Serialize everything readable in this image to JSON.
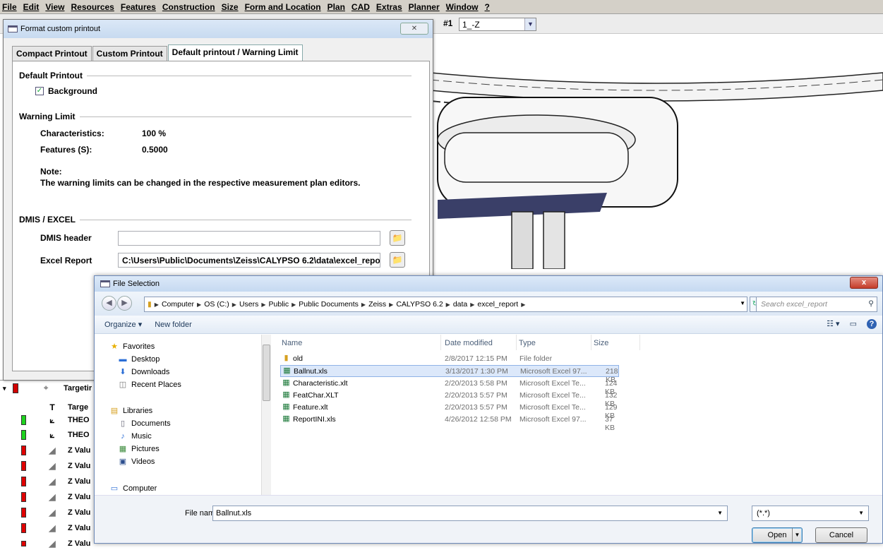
{
  "menubar": {
    "items": [
      "File",
      "Edit",
      "View",
      "Resources",
      "Features",
      "Construction",
      "Size",
      "Form and Location",
      "Plan",
      "CAD",
      "Extras",
      "Planner",
      "Window",
      "?"
    ]
  },
  "toolbar": {
    "plan_number": "#1",
    "plan_combo_value": "1_-Z"
  },
  "tree": {
    "header": "Targetir",
    "rows": [
      {
        "icon": "text-icon",
        "label": "Targe",
        "flag": ""
      },
      {
        "icon": "axis-icon",
        "label": "THEO",
        "flag": "green"
      },
      {
        "icon": "axis-icon",
        "label": "THEO",
        "flag": "green"
      },
      {
        "icon": "feature-icon",
        "label": "Z Valu",
        "flag": "red"
      },
      {
        "icon": "feature-icon",
        "label": "Z Valu",
        "flag": "red"
      },
      {
        "icon": "feature-icon",
        "label": "Z Valu",
        "flag": "red"
      },
      {
        "icon": "feature-icon",
        "label": "Z Valu",
        "flag": "red"
      },
      {
        "icon": "feature-icon",
        "label": "Z Valu",
        "flag": "red"
      },
      {
        "icon": "feature-icon",
        "label": "Z Valu",
        "flag": "red"
      },
      {
        "icon": "feature-icon",
        "label": "Z Valu",
        "flag": "red"
      }
    ]
  },
  "format_dialog": {
    "title": "Format custom printout",
    "close_label": "✕",
    "tabs": [
      "Compact Printout",
      "Custom Printout",
      "Default printout / Warning Limit"
    ],
    "default_printout": {
      "group_label": "Default Printout",
      "background_label": "Background",
      "background_checked": true
    },
    "warning_limit": {
      "group_label": "Warning Limit",
      "characteristics_label": "Characteristics:",
      "characteristics_value": "100 %",
      "features_label": "Features (S):",
      "features_value": "0.5000",
      "note_title": "Note:",
      "note_text": "The warning limits can be changed in the respective measurement plan editors."
    },
    "dmis_excel": {
      "group_label": "DMIS / EXCEL",
      "dmis_header_label": "DMIS header",
      "dmis_header_value": "",
      "excel_report_label": "Excel Report",
      "excel_report_value": "C:\\Users\\Public\\Documents\\Zeiss\\CALYPSO 6.2\\data\\excel_report"
    }
  },
  "file_dialog": {
    "title": "File Selection",
    "close_label": "x",
    "breadcrumb": [
      "Computer",
      "OS (C:)",
      "Users",
      "Public",
      "Public Documents",
      "Zeiss",
      "CALYPSO 6.2",
      "data",
      "excel_report"
    ],
    "search_placeholder": "Search excel_report",
    "organize_label": "Organize ▾",
    "new_folder_label": "New folder",
    "nav": [
      {
        "icon": "star-icon",
        "label": "Favorites"
      },
      {
        "icon": "desktop-icon",
        "label": "Desktop"
      },
      {
        "icon": "downloads-icon",
        "label": "Downloads"
      },
      {
        "icon": "recent-icon",
        "label": "Recent Places"
      },
      {
        "icon": "libraries-icon",
        "label": "Libraries"
      },
      {
        "icon": "documents-icon",
        "label": "Documents"
      },
      {
        "icon": "music-icon",
        "label": "Music"
      },
      {
        "icon": "pictures-icon",
        "label": "Pictures"
      },
      {
        "icon": "videos-icon",
        "label": "Videos"
      },
      {
        "icon": "computer-icon",
        "label": "Computer"
      }
    ],
    "columns": [
      "Name",
      "Date modified",
      "Type",
      "Size"
    ],
    "files": [
      {
        "name": "old",
        "date": "2/8/2017 12:15 PM",
        "type": "File folder",
        "size": "",
        "kind": "folder",
        "selected": false
      },
      {
        "name": "Ballnut.xls",
        "date": "3/13/2017 1:30 PM",
        "type": "Microsoft Excel 97...",
        "size": "218 KB",
        "kind": "excel",
        "selected": true
      },
      {
        "name": "Characteristic.xlt",
        "date": "2/20/2013 5:58 PM",
        "type": "Microsoft Excel Te...",
        "size": "124 KB",
        "kind": "excel",
        "selected": false
      },
      {
        "name": "FeatChar.XLT",
        "date": "2/20/2013 5:57 PM",
        "type": "Microsoft Excel Te...",
        "size": "132 KB",
        "kind": "excel",
        "selected": false
      },
      {
        "name": "Feature.xlt",
        "date": "2/20/2013 5:57 PM",
        "type": "Microsoft Excel Te...",
        "size": "129 KB",
        "kind": "excel",
        "selected": false
      },
      {
        "name": "ReportINI.xls",
        "date": "4/26/2012 12:58 PM",
        "type": "Microsoft Excel 97...",
        "size": "37 KB",
        "kind": "excel",
        "selected": false
      }
    ],
    "file_name_label": "File name:",
    "file_name_value": "Ballnut.xls",
    "file_type_value": "(*.*)",
    "open_label": "Open",
    "cancel_label": "Cancel"
  }
}
